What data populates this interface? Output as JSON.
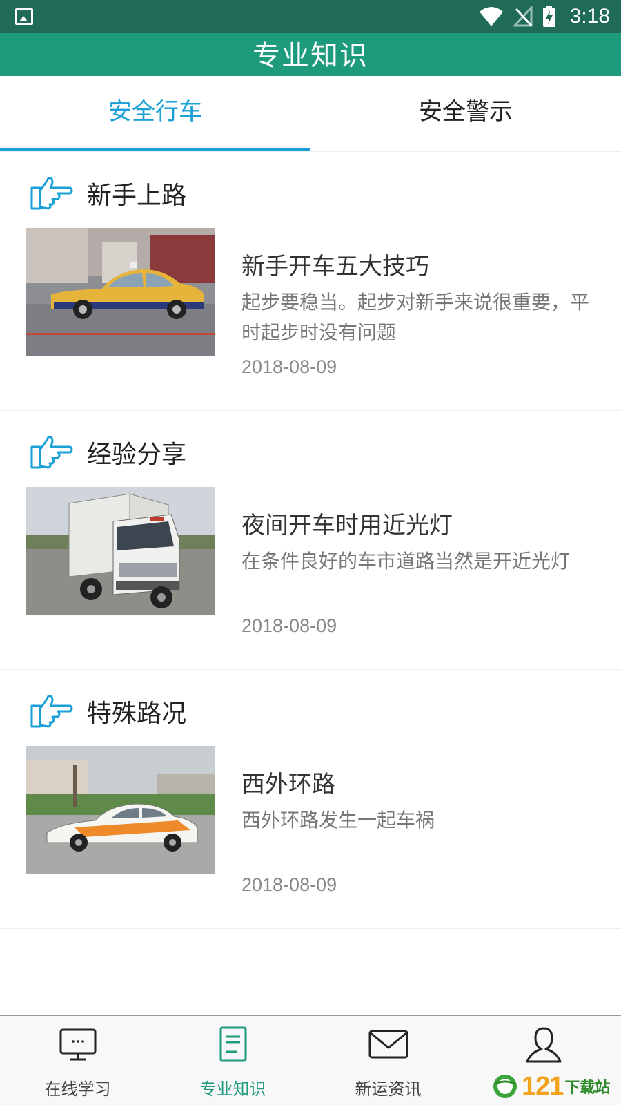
{
  "status_bar": {
    "time": "3:18"
  },
  "header": {
    "title": "专业知识"
  },
  "tabs": [
    {
      "label": "安全行车",
      "active": true
    },
    {
      "label": "安全警示",
      "active": false
    }
  ],
  "sections": [
    {
      "title": "新手上路",
      "image": "taxi-photo",
      "article": {
        "title": "新手开车五大技巧",
        "summary": "起步要稳当。起步对新手来说很重要，平时起步时没有问题",
        "date": "2018-08-09"
      }
    },
    {
      "title": "经验分享",
      "image": "jac-truck-photo",
      "article": {
        "title": "夜间开车时用近光灯",
        "summary": "在条件良好的车市道路当然是开近光灯",
        "date": "2018-08-09"
      }
    },
    {
      "title": "特殊路况",
      "image": "driving-school-car-photo",
      "article": {
        "title": "西外环路",
        "summary": "西外环路发生一起车祸",
        "date": "2018-08-09"
      }
    }
  ],
  "bottom_nav": [
    {
      "label": "在线学习",
      "icon": "monitor-icon",
      "active": false
    },
    {
      "label": "专业知识",
      "icon": "document-icon",
      "active": true
    },
    {
      "label": "新运资讯",
      "icon": "mail-icon",
      "active": false
    },
    {
      "label": "",
      "icon": "user-icon",
      "active": false
    }
  ],
  "watermark": {
    "brand": "121",
    "cn": "下载站"
  },
  "colors": {
    "status_bar": "#1f6b57",
    "header": "#1e9b7d",
    "tab_active": "#1aa0d7",
    "nav_active": "#1e9b7d"
  }
}
